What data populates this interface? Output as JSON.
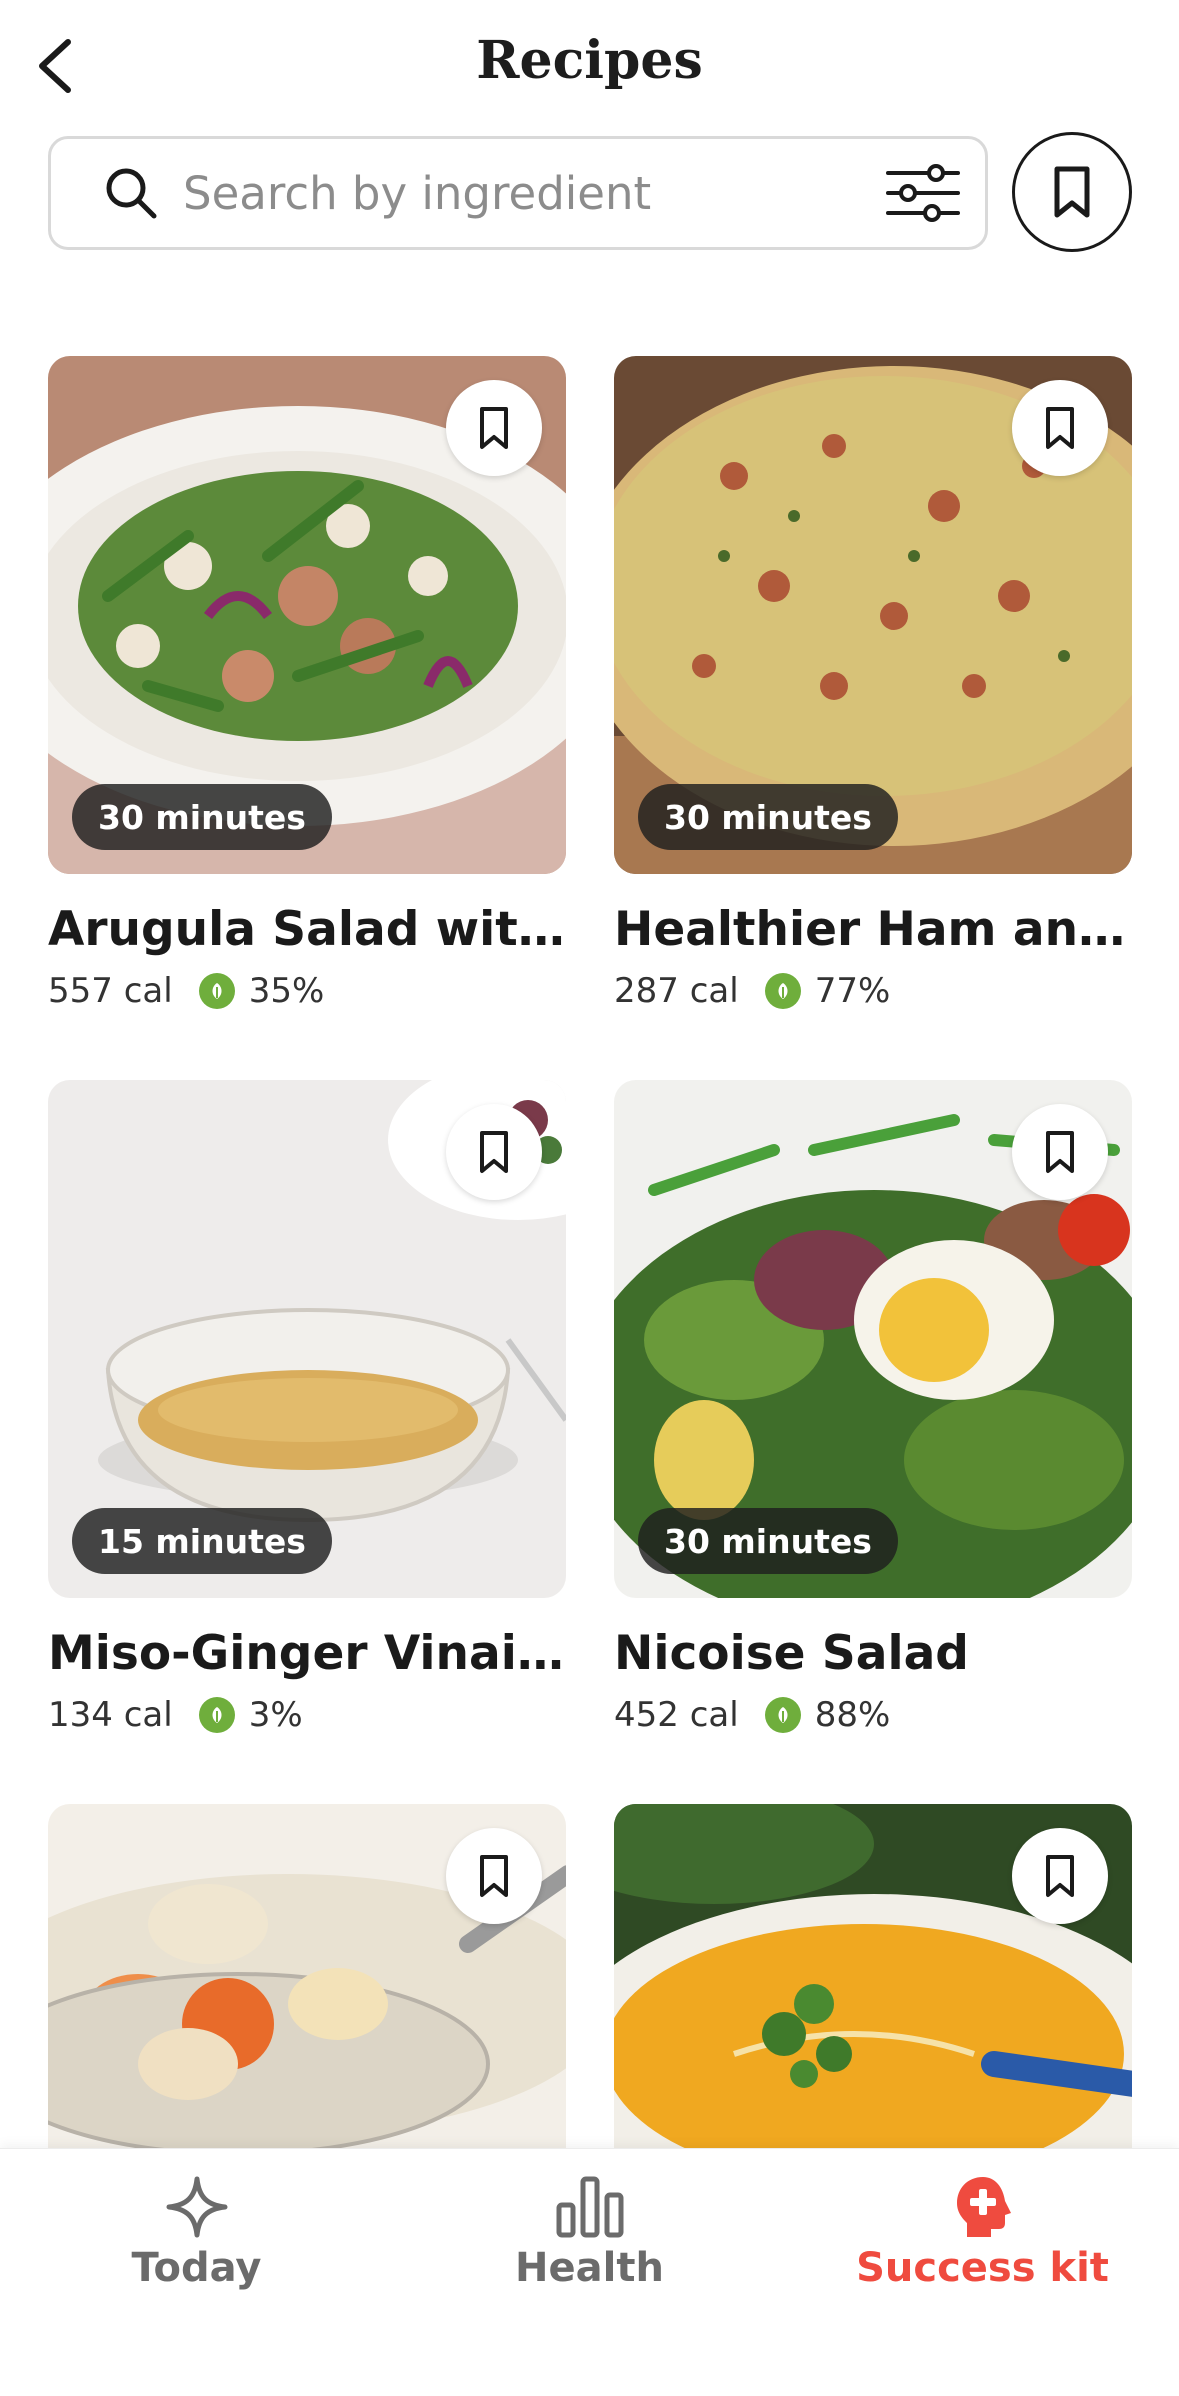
{
  "header": {
    "title": "Recipes"
  },
  "search": {
    "placeholder": "Search by ingredient"
  },
  "recipes": [
    {
      "title": "Arugula Salad with...",
      "time": "30 minutes",
      "calories": "557 cal",
      "score": "35%"
    },
    {
      "title": "Healthier Ham and...",
      "time": "30 minutes",
      "calories": "287 cal",
      "score": "77%"
    },
    {
      "title": "Miso-Ginger Vinaigr...",
      "time": "15 minutes",
      "calories": "134 cal",
      "score": "3%"
    },
    {
      "title": "Nicoise Salad",
      "time": "30 minutes",
      "calories": "452 cal",
      "score": "88%"
    },
    {
      "title": "",
      "time": "",
      "calories": "",
      "score": ""
    },
    {
      "title": "",
      "time": "",
      "calories": "",
      "score": ""
    }
  ],
  "tabs": [
    {
      "label": "Today",
      "icon": "sparkle-icon"
    },
    {
      "label": "Health",
      "icon": "bar-chart-icon"
    },
    {
      "label": "Success kit",
      "icon": "head-plus-icon",
      "active": true
    }
  ],
  "colors": {
    "accent": "#ef4b3f",
    "score_green": "#6fae3c",
    "text": "#1a1a1a"
  }
}
